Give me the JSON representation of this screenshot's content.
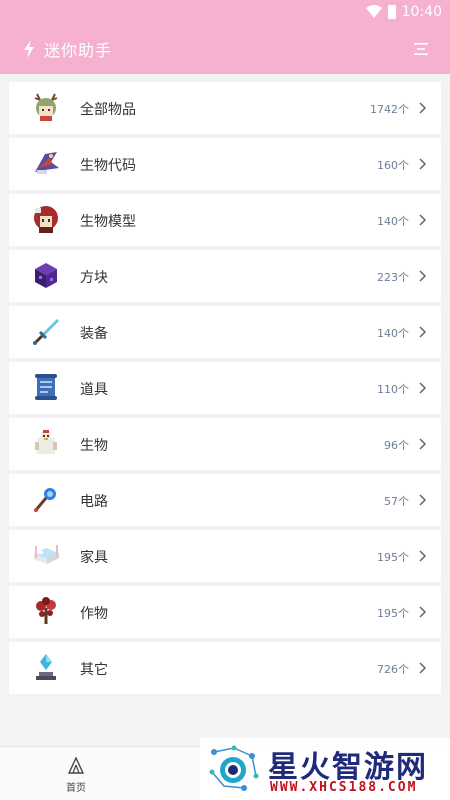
{
  "status": {
    "time": "10:40"
  },
  "header": {
    "title": "迷你助手"
  },
  "categories": [
    {
      "label": "全部物品",
      "count": "1742个",
      "icon": "deer-girl-icon"
    },
    {
      "label": "生物代码",
      "count": "160个",
      "icon": "dragon-creature-icon"
    },
    {
      "label": "生物模型",
      "count": "140个",
      "icon": "red-hair-girl-icon"
    },
    {
      "label": "方块",
      "count": "223个",
      "icon": "purple-block-icon"
    },
    {
      "label": "装备",
      "count": "140个",
      "icon": "sword-icon"
    },
    {
      "label": "道具",
      "count": "110个",
      "icon": "scroll-icon"
    },
    {
      "label": "生物",
      "count": "96个",
      "icon": "chicken-icon"
    },
    {
      "label": "电路",
      "count": "57个",
      "icon": "wand-icon"
    },
    {
      "label": "家具",
      "count": "195个",
      "icon": "bed-icon"
    },
    {
      "label": "作物",
      "count": "195个",
      "icon": "plant-icon"
    },
    {
      "label": "其它",
      "count": "726个",
      "icon": "crystal-icon"
    }
  ],
  "bottom_nav": {
    "home_label": "首页"
  },
  "watermark": {
    "title": "星火智游网",
    "url": "WWW.XHCS188.COM"
  },
  "colors": {
    "accent": "#f5b1cf",
    "count_text": "#6e7f99"
  }
}
